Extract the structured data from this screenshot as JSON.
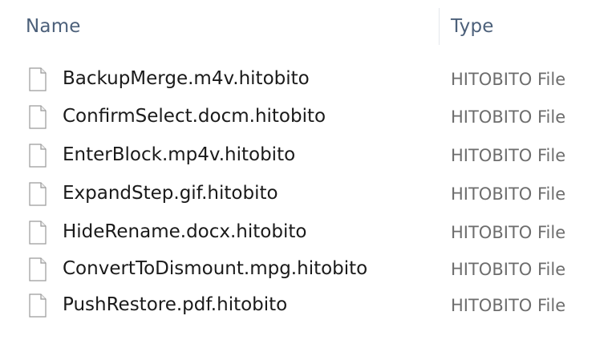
{
  "header": {
    "name_label": "Name",
    "type_label": "Type"
  },
  "files": [
    {
      "name": "BackupMerge.m4v.hitobito",
      "type": "HITOBITO File",
      "icon": "file-icon"
    },
    {
      "name": "ConfirmSelect.docm.hitobito",
      "type": "HITOBITO File",
      "icon": "file-icon"
    },
    {
      "name": "EnterBlock.mp4v.hitobito",
      "type": "HITOBITO File",
      "icon": "file-icon"
    },
    {
      "name": "ExpandStep.gif.hitobito",
      "type": "HITOBITO File",
      "icon": "file-icon"
    },
    {
      "name": "HideRename.docx.hitobito",
      "type": "HITOBITO File",
      "icon": "file-icon"
    },
    {
      "name": "ConvertToDismount.mpg.hitobito",
      "type": "HITOBITO File",
      "icon": "file-icon"
    },
    {
      "name": "PushRestore.pdf.hitobito",
      "type": "HITOBITO File",
      "icon": "file-icon"
    }
  ],
  "colors": {
    "header_text": "#4c607a",
    "name_text": "#1a1a1a",
    "type_text": "#6d6d6d"
  }
}
